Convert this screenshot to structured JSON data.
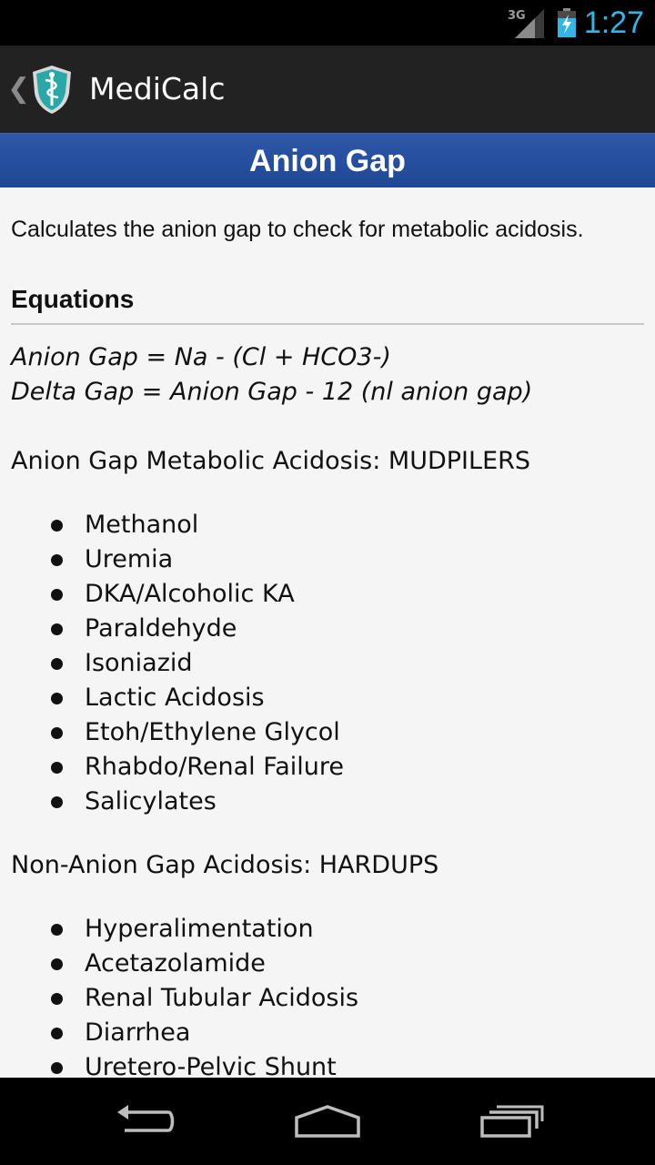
{
  "status_bar": {
    "network": "3G",
    "time": "1:27",
    "accent_color": "#33b5e5",
    "icons": [
      "signal-icon",
      "battery-charging-icon"
    ]
  },
  "action_bar": {
    "app_name": "MediCalc",
    "icons": [
      "back-chevron-icon",
      "medicalc-shield-icon"
    ]
  },
  "page": {
    "title": "Anion Gap",
    "banner_color": "#2a52a3",
    "description": "Calculates the anion gap to check for metabolic acidosis.",
    "equations_heading": "Equations",
    "equations": [
      "Anion Gap = Na - (Cl + HCO3-)",
      "Delta Gap = Anion Gap - 12 (nl anion gap)"
    ],
    "groups": [
      {
        "heading": "Anion Gap Metabolic Acidosis: MUDPILERS",
        "items": [
          "Methanol",
          "Uremia",
          "DKA/Alcoholic KA",
          "Paraldehyde",
          "Isoniazid",
          "Lactic Acidosis",
          "Etoh/Ethylene Glycol",
          "Rhabdo/Renal Failure",
          "Salicylates"
        ]
      },
      {
        "heading": "Non-Anion Gap Acidosis: HARDUPS",
        "items": [
          "Hyperalimentation",
          "Acetazolamide",
          "Renal Tubular Acidosis",
          "Diarrhea",
          "Uretero-Pelvic Shunt"
        ]
      }
    ]
  },
  "nav_bar": {
    "icons": [
      "back-icon",
      "home-icon",
      "recent-apps-icon"
    ]
  }
}
